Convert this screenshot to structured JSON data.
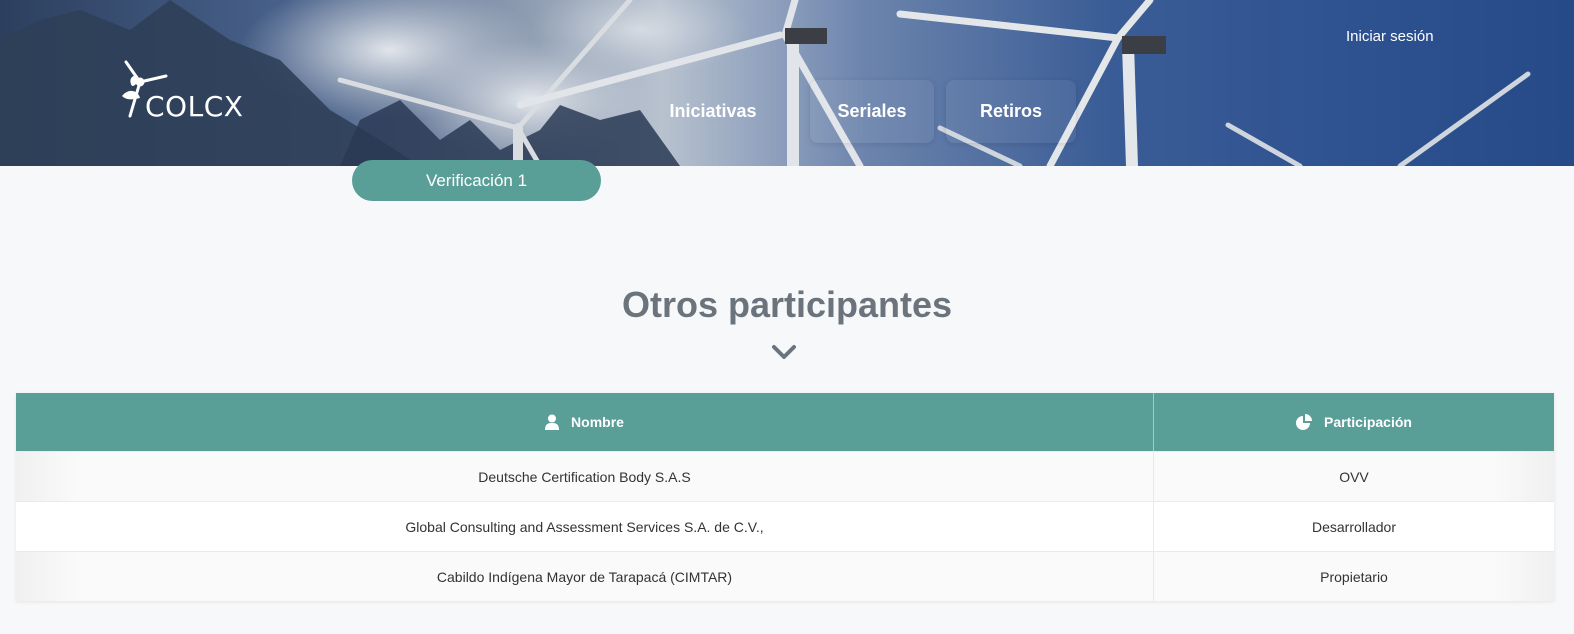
{
  "header": {
    "brand": "COLCX",
    "login_label": "Iniciar sesión",
    "nav": [
      {
        "label": "Iniciativas"
      },
      {
        "label": "Seriales"
      },
      {
        "label": "Retiros"
      }
    ]
  },
  "verification_tab": {
    "label": "Verificación 1"
  },
  "participants": {
    "title": "Otros participantes",
    "toggle_icon": "chevron-down-icon",
    "columns": {
      "name": {
        "label": "Nombre",
        "icon": "user-icon"
      },
      "participation": {
        "label": "Participación",
        "icon": "pie-chart-icon"
      }
    },
    "rows": [
      {
        "name": "Deutsche Certification Body S.A.S",
        "participation": "OVV"
      },
      {
        "name": "Global Consulting and Assessment Services S.A. de C.V.,",
        "participation": "Desarrollador"
      },
      {
        "name": "Cabildo Indígena Mayor de Tarapacá (CIMTAR)",
        "participation": "Propietario"
      }
    ]
  },
  "colors": {
    "accent": "#5a9e98",
    "title_gray": "#6b747c",
    "page_bg": "#f7f8fa"
  }
}
